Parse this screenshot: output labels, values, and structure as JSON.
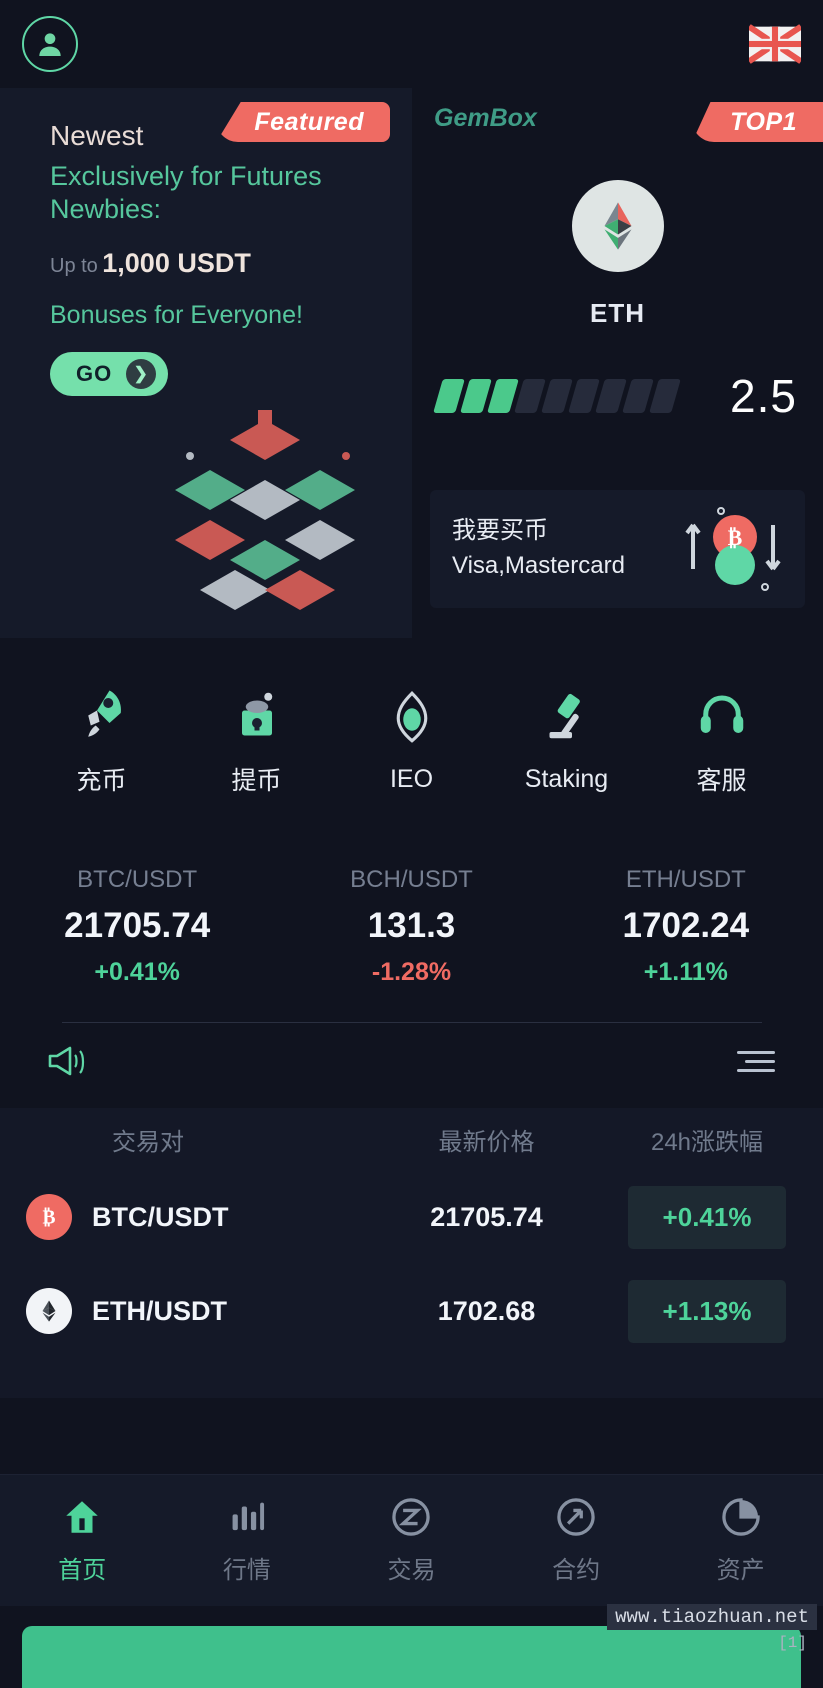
{
  "header": {
    "avatar_icon": "user-avatar-icon",
    "language_flag": "uk-flag-icon"
  },
  "promo": {
    "ribbon_label": "Featured",
    "line_newest": "Newest",
    "line_head": "Exclusively for Futures Newbies:",
    "upto_label": "Up to",
    "amount": "1,000 USDT",
    "bonus_line": "Bonuses for Everyone!",
    "cta_label": "GO"
  },
  "gembox": {
    "title": "GemBox",
    "ribbon_label": "TOP1",
    "coin": "ETH",
    "coin_icon": "ethereum-icon",
    "progress_value": "2.5",
    "segments_total": 9,
    "segments_filled": 3
  },
  "buy_crypto": {
    "title": "我要买币",
    "subtitle": "Visa,Mastercard",
    "icon": "buy-sell-arrows-icon"
  },
  "quick_actions": [
    {
      "label": "充币",
      "icon": "rocket-icon"
    },
    {
      "label": "提币",
      "icon": "safe-vault-icon"
    },
    {
      "label": "IEO",
      "icon": "gem-icon"
    },
    {
      "label": "Staking",
      "icon": "gavel-icon"
    },
    {
      "label": "客服",
      "icon": "headset-icon"
    }
  ],
  "tickers": [
    {
      "pair": "BTC/USDT",
      "price": "21705.74",
      "change": "+0.41%",
      "dir": "up"
    },
    {
      "pair": "BCH/USDT",
      "price": "131.3",
      "change": "-1.28%",
      "dir": "down"
    },
    {
      "pair": "ETH/USDT",
      "price": "1702.24",
      "change": "+1.11%",
      "dir": "up"
    }
  ],
  "notice": {
    "megaphone_icon": "megaphone-icon",
    "menu_icon": "list-menu-icon"
  },
  "market": {
    "columns": {
      "pair": "交易对",
      "price": "最新价格",
      "change": "24h涨跌幅"
    },
    "rows": [
      {
        "pair": "BTC/USDT",
        "price": "21705.74",
        "change": "+0.41%",
        "icon": "bitcoin-icon"
      },
      {
        "pair": "ETH/USDT",
        "price": "1702.68",
        "change": "+1.13%",
        "icon": "ethereum-icon"
      }
    ]
  },
  "tabbar": [
    {
      "label": "首页",
      "icon": "home-icon",
      "active": true
    },
    {
      "label": "行情",
      "icon": "market-bars-icon",
      "active": false
    },
    {
      "label": "交易",
      "icon": "swap-icon",
      "active": false
    },
    {
      "label": "合约",
      "icon": "contract-compass-icon",
      "active": false
    },
    {
      "label": "资产",
      "icon": "assets-pie-icon",
      "active": false
    }
  ],
  "watermark": {
    "text": "www.tiaozhuan.net",
    "sub": "[1]"
  },
  "colors": {
    "accent": "#4ed39a",
    "danger": "#ef6b63",
    "bg": "#10131f",
    "card": "#151a29"
  }
}
